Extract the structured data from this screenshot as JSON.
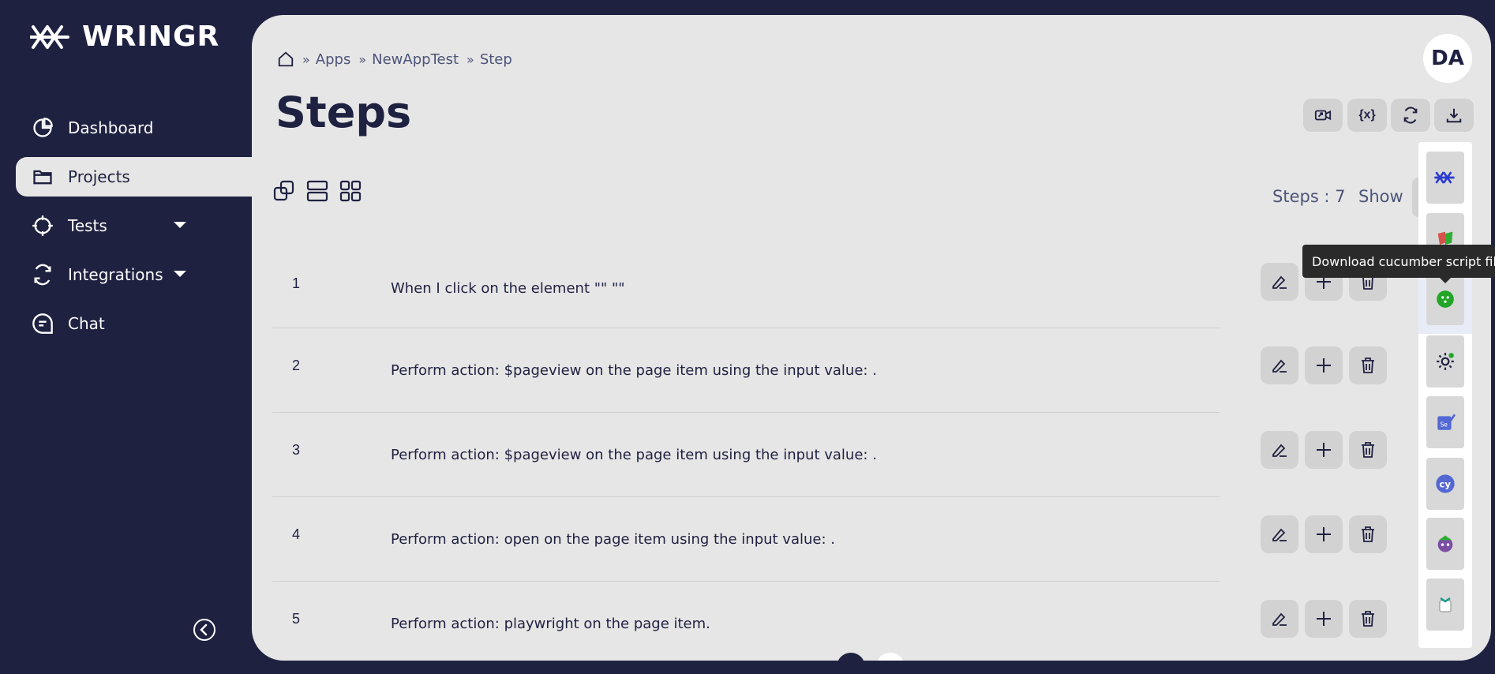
{
  "app": {
    "name": "WRINGR"
  },
  "sidebar": {
    "items": [
      {
        "label": "Dashboard",
        "icon": "pie-chart-icon"
      },
      {
        "label": "Projects",
        "icon": "folder-icon",
        "active": true
      },
      {
        "label": "Tests",
        "icon": "crosshair-icon",
        "has_dropdown": true
      },
      {
        "label": "Integrations",
        "icon": "refresh-icon",
        "has_dropdown": true
      },
      {
        "label": "Chat",
        "icon": "chat-icon"
      }
    ]
  },
  "breadcrumb": {
    "items": [
      "Apps",
      "NewAppTest",
      "Step"
    ]
  },
  "page": {
    "title": "Steps",
    "avatar_initials": "DA"
  },
  "toolbar": {
    "buttons": [
      "camera-share-icon",
      "variable-icon",
      "refresh-icon",
      "download-icon"
    ],
    "variable_glyph": "{x}"
  },
  "views": [
    "copy-view-icon",
    "list-view-icon",
    "grid-view-icon"
  ],
  "summary": {
    "steps_label": "Steps : 7",
    "show_label": "Show"
  },
  "steps": [
    {
      "num": "1",
      "text": "When I click on the element \"\" \"\""
    },
    {
      "num": "2",
      "text": "Perform action: $pageview on the page item using the input value: ."
    },
    {
      "num": "3",
      "text": "Perform action: $pageview on the page item using the input value: ."
    },
    {
      "num": "4",
      "text": "Perform action: open on the page item using the input value: ."
    },
    {
      "num": "5",
      "text": "Perform action: playwright on the page item."
    }
  ],
  "integrations": [
    "wringr-icon",
    "playwright-icon",
    "cucumber-icon",
    "settings-check-icon",
    "selenium-icon",
    "cypress-icon",
    "robot-framework-icon",
    "other-tool-icon"
  ],
  "tooltip": {
    "text": "Download cucumber script file"
  },
  "colors": {
    "sidebar_bg": "#1f2141",
    "main_bg": "#e6e6e6",
    "button_bg": "#d2d2d2"
  }
}
